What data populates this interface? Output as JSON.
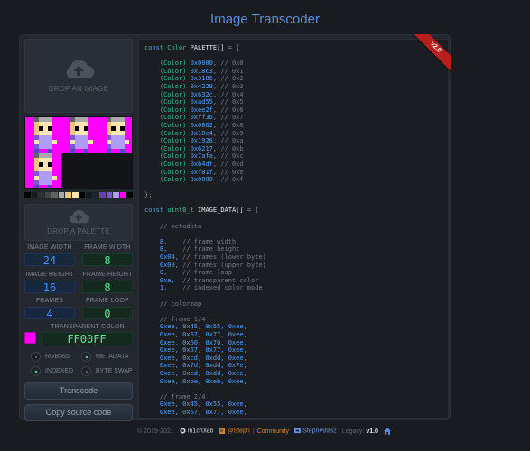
{
  "header": {
    "title": "Image Transcoder"
  },
  "ribbon": {
    "label": "v2.0"
  },
  "left_panel": {
    "image_drop": {
      "label": "DROP AN IMAGE",
      "icon": "cloud-upload-icon"
    },
    "palette_drop": {
      "label": "DROP A PALETTE",
      "icon": "cloud-upload-icon"
    },
    "palette_colors": [
      "#000000",
      "#1b1b1b",
      "#303030",
      "#444444",
      "#636363",
      "#aaaaaa",
      "#eec47c",
      "#ffe6b0",
      "#000000",
      "#101c20",
      "#1c2430",
      "#6040c0",
      "#7858d8",
      "#b09cf8",
      "#ff00ff",
      "#000000"
    ],
    "fields": {
      "image_width": {
        "label": "IMAGE WIDTH",
        "value": "24"
      },
      "frame_width": {
        "label": "FRAME WIDTH",
        "value": "8"
      },
      "image_height": {
        "label": "IMAGE HEIGHT",
        "value": "16"
      },
      "frame_height": {
        "label": "FRAME HEIGHT",
        "value": "8"
      },
      "frames": {
        "label": "FRAMES",
        "value": "4"
      },
      "frame_loop": {
        "label": "FRAME LOOP",
        "value": "0"
      }
    },
    "transparent_color": {
      "label": "TRANSPARENT COLOR",
      "value": "FF00FF",
      "swatch": "#ff00ff"
    },
    "options": [
      {
        "label": "RGB565",
        "checked": false
      },
      {
        "label": "METADATA",
        "checked": true
      },
      {
        "label": "INDEXED",
        "checked": true
      },
      {
        "label": "BYTE SWAP",
        "checked": false
      }
    ],
    "buttons": {
      "transcode": "Transcode",
      "copy": "Copy source code"
    }
  },
  "code": {
    "palette_decl": {
      "kw": "const",
      "type": "Color",
      "name": "PALETTE[]",
      "rest": " = {"
    },
    "palette_entries": [
      [
        "0x0000",
        "0x0"
      ],
      [
        "0x18c3",
        "0x1"
      ],
      [
        "0x3186",
        "0x2"
      ],
      [
        "0x4228",
        "0x3"
      ],
      [
        "0x632c",
        "0x4"
      ],
      [
        "0xad55",
        "0x5"
      ],
      [
        "0xee2f",
        "0x6"
      ],
      [
        "0xff36",
        "0x7"
      ],
      [
        "0x0862",
        "0x8"
      ],
      [
        "0x10e4",
        "0x9"
      ],
      [
        "0x1926",
        "0xa"
      ],
      [
        "0x6217",
        "0xb"
      ],
      [
        "0x7afa",
        "0xc"
      ],
      [
        "0xb4df",
        "0xd"
      ],
      [
        "0xf81f",
        "0xe"
      ],
      [
        "0x0000",
        "0xf"
      ]
    ],
    "cast": "(Color)",
    "close": "};",
    "data_decl": {
      "kw": "const",
      "type": "uint8_t",
      "name": "IMAGE_DATA[]",
      "rest": " = {"
    },
    "metadata_comment": "// metadata",
    "metadata": [
      [
        "8,",
        "// frame width"
      ],
      [
        "8,",
        "// frame height"
      ],
      [
        "0x04,",
        "// frames (lower byte)"
      ],
      [
        "0x00,",
        "// frames (upper byte)"
      ],
      [
        "0,",
        "// frame loop"
      ],
      [
        "0xe,",
        "// transparent color"
      ],
      [
        "1,",
        "// indexed color mode"
      ]
    ],
    "colormap_comment": "// colormap",
    "frame1_comment": "// frame 1/4",
    "frame1": [
      "0xee, 0x45, 0x55, 0xee,",
      "0xee, 0x67, 0x77, 0xee,",
      "0xee, 0x60, 0x70, 0xee,",
      "0xee, 0x67, 0x77, 0xee,",
      "0xee, 0xcd, 0xdd, 0xee,",
      "0xee, 0x7d, 0xdd, 0x7e,",
      "0xee, 0xcd, 0xdd, 0xee,",
      "0xee, 0xbe, 0xeb, 0xee,"
    ],
    "frame2_comment": "// frame 2/4",
    "frame2": [
      "0xee, 0x45, 0x55, 0xee,",
      "0xee, 0x67, 0x77, 0xee,"
    ]
  },
  "footer": {
    "copyright": "© 2019-2021",
    "github": "m1cr0lab",
    "forum_user": "@Steph",
    "separator": "|",
    "community": "Community",
    "discord": "Steph#9932",
    "legacy_label": "Legacy:",
    "legacy_version": "v1.0"
  }
}
